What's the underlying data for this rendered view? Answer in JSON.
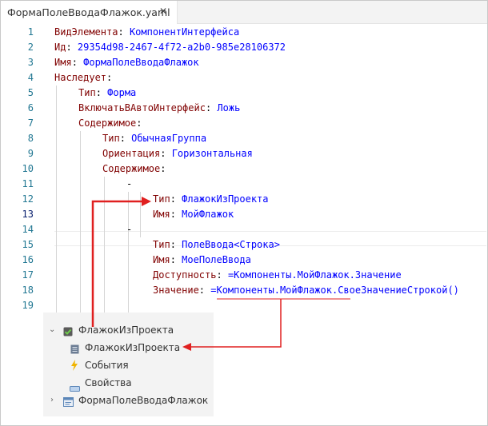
{
  "tab": {
    "title": "ФормаПолеВводаФлажок.yaml",
    "close_glyph": "✕"
  },
  "editor": {
    "lines": [
      {
        "n": "1",
        "key": "ВидЭлемента",
        "value": "КомпонентИнтерфейса"
      },
      {
        "n": "2",
        "key": "Ид",
        "value": "29354d98-2467-4f72-a2b0-985e28106372"
      },
      {
        "n": "3",
        "key": "Имя",
        "value": "ФормаПолеВводаФлажок"
      },
      {
        "n": "4",
        "key": "Наследует",
        "value": ""
      },
      {
        "n": "5",
        "key": "Тип",
        "value": "Форма"
      },
      {
        "n": "6",
        "key": "ВключатьВАвтоИнтерфейс",
        "value": "Ложь"
      },
      {
        "n": "7",
        "key": "Содержимое",
        "value": ""
      },
      {
        "n": "8",
        "key": "Тип",
        "value": "ОбычнаяГруппа"
      },
      {
        "n": "9",
        "key": "Ориентация",
        "value": "Горизонтальная"
      },
      {
        "n": "10",
        "key": "Содержимое",
        "value": ""
      },
      {
        "n": "11",
        "dash": "-"
      },
      {
        "n": "12",
        "key": "Тип",
        "value": "ФлажокИзПроекта"
      },
      {
        "n": "13",
        "key": "Имя",
        "value": "МойФлажок"
      },
      {
        "n": "14",
        "dash": "-"
      },
      {
        "n": "15",
        "key": "Тип",
        "value": "ПолеВвода<Строка>"
      },
      {
        "n": "16",
        "key": "Имя",
        "value": "МоеПолеВвода"
      },
      {
        "n": "17",
        "key": "Доступность",
        "value": "=Компоненты.МойФлажок.Значение"
      },
      {
        "n": "18",
        "key": "Значение",
        "value": "=Компоненты.МойФлажок.СвоеЗначениеСтрокой()"
      },
      {
        "n": "19"
      }
    ]
  },
  "tree": {
    "root_label": "ФлажокИзПроекта",
    "child_component": "ФлажокИзПроекта",
    "child_events": "События",
    "child_properties": "Свойства",
    "form_label": "ФормаПолеВводаФлажок"
  },
  "colors": {
    "line_number": "#237893",
    "key": "#800000",
    "value": "#0000ff",
    "arrow": "#e02020"
  }
}
